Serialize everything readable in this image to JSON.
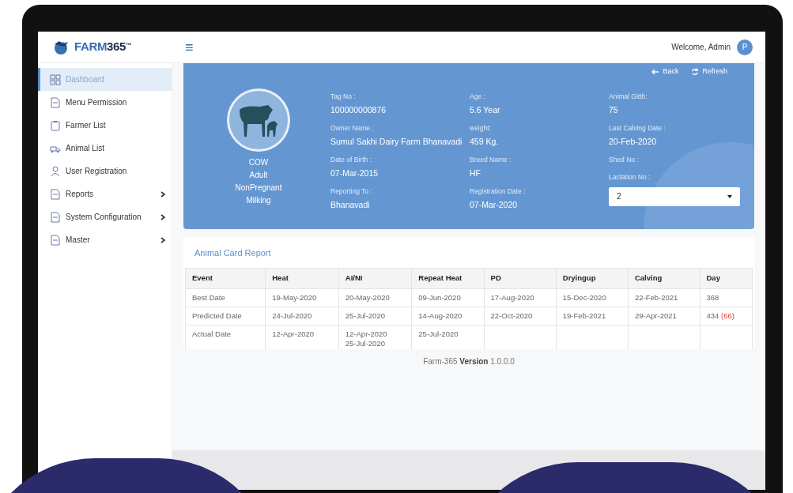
{
  "logo": {
    "text": "FARM",
    "accent": "365",
    "mark": "™"
  },
  "header": {
    "menu_glyph": "≡",
    "welcome": "Welcome, Admin",
    "avatar": "P"
  },
  "sidebar": {
    "items": [
      {
        "label": "Dashboard",
        "kind": "dashboard",
        "selected": true,
        "expandable": false
      },
      {
        "label": "Menu Permission",
        "kind": "page",
        "selected": false,
        "expandable": false
      },
      {
        "label": "Farmer List",
        "kind": "list",
        "selected": false,
        "expandable": false
      },
      {
        "label": "Animal List",
        "kind": "animal",
        "selected": false,
        "expandable": false
      },
      {
        "label": "User Registration",
        "kind": "user",
        "selected": false,
        "expandable": false
      },
      {
        "label": "Reports",
        "kind": "page",
        "selected": false,
        "expandable": true
      },
      {
        "label": "System Configuration",
        "kind": "page",
        "selected": false,
        "expandable": true
      },
      {
        "label": "Master",
        "kind": "page",
        "selected": false,
        "expandable": true
      }
    ]
  },
  "animal_card": {
    "actions": [
      {
        "label": "Back",
        "kind": "back"
      },
      {
        "label": "Refresh",
        "kind": "refresh"
      }
    ],
    "status_lines": [
      "COW",
      "Adult",
      "NonPregnant",
      "Milking"
    ],
    "columns": [
      [
        {
          "label": "Tag No :",
          "value": "100000000876"
        },
        {
          "label": "Owner Name :",
          "value": "Sumul Sakhi Dairy Farm Bhanavadi"
        },
        {
          "label": "Date of Birth :",
          "value": "07-Mar-2015"
        },
        {
          "label": "Reporting To :",
          "value": "Bhanavadi"
        }
      ],
      [
        {
          "label": "Age :",
          "value": "5.6 Year"
        },
        {
          "label": "weight:",
          "value": "459 Kg."
        },
        {
          "label": "Breed Name :",
          "value": "HF"
        },
        {
          "label": "Registration Date :",
          "value": "07-Mar-2020"
        }
      ],
      [
        {
          "label": "Animal Gitth:",
          "value": "75"
        },
        {
          "label": "Last Calving Date :",
          "value": "20-Feb-2020"
        },
        {
          "label": "Shed No :"
        }
      ]
    ],
    "lactation": {
      "label": "Lactation No :",
      "value": "2"
    }
  },
  "report": {
    "title": "Animal Card Report",
    "columns": [
      "Event",
      "Heat",
      "AI/NI",
      "Repeat Heat",
      "PD",
      "Dryingup",
      "Calving",
      "Day"
    ],
    "rows": [
      {
        "cells": [
          [
            "Best Date"
          ],
          [
            "19-May-2020"
          ],
          [
            "20-May-2020"
          ],
          [
            "09-Jun-2020"
          ],
          [
            "17-Aug-2020"
          ],
          [
            "15-Dec-2020"
          ],
          [
            "22-Feb-2021"
          ],
          [
            "368"
          ]
        ]
      },
      {
        "cells": [
          [
            "Predicted Date"
          ],
          [
            "24-Jul-2020"
          ],
          [
            "25-Jul-2020"
          ],
          [
            "14-Aug-2020"
          ],
          [
            "22-Oct-2020"
          ],
          [
            "19-Feb-2021"
          ],
          [
            "29-Apr-2021"
          ],
          [
            "434"
          ]
        ],
        "day_note": "(66)"
      },
      {
        "cells": [
          [
            "Actual Date"
          ],
          [
            "12-Apr-2020"
          ],
          [
            "12-Apr-2020",
            "25-Jul-2020"
          ],
          [
            "25-Jul-2020"
          ],
          [],
          [],
          [],
          []
        ]
      }
    ]
  },
  "footer": {
    "name": "Farm-365",
    "strong": "Version",
    "version": "1.0.0.0"
  }
}
